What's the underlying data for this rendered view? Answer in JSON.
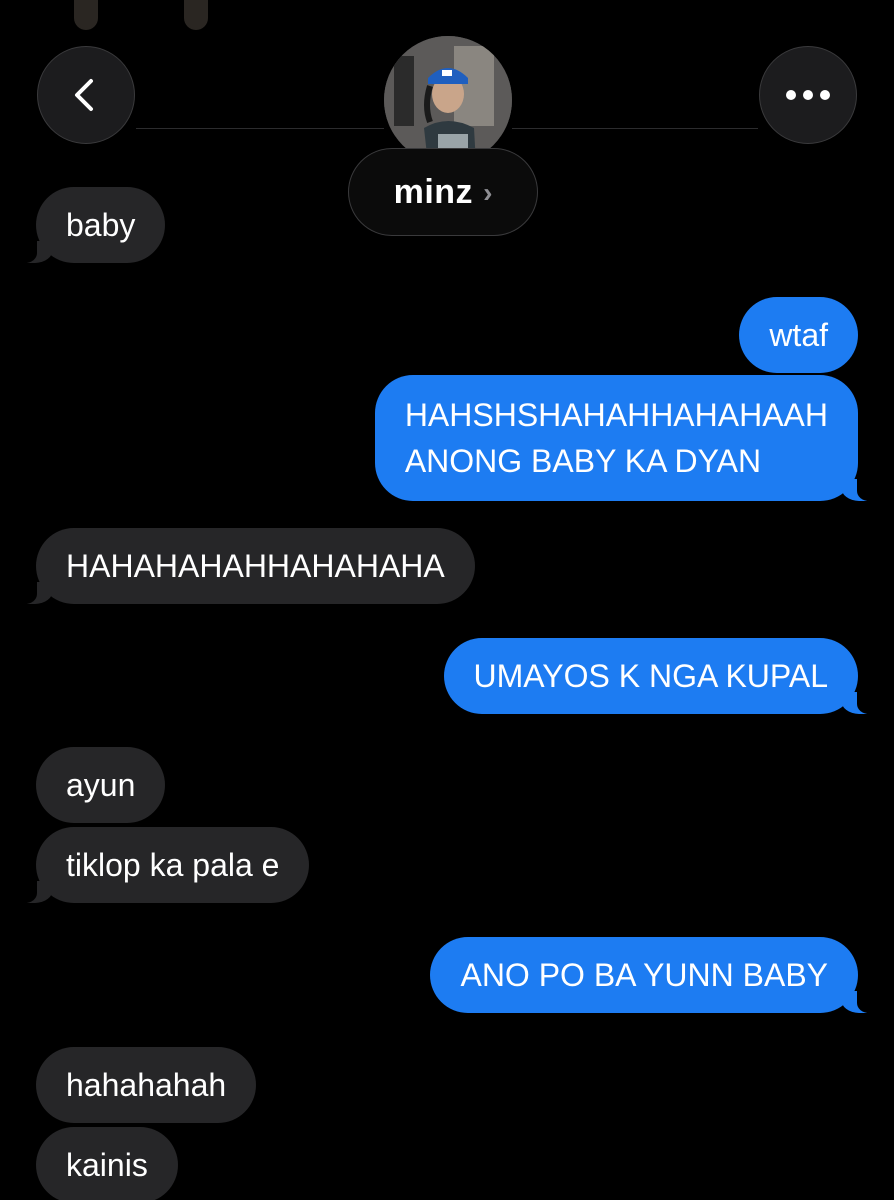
{
  "contact": {
    "name": "minz",
    "chevron": "›"
  },
  "header": {
    "back_icon": "chevron-left-icon",
    "more_icon": "ellipsis-icon"
  },
  "messages": [
    {
      "from": "them",
      "lines": [
        "baby"
      ]
    },
    {
      "from": "me",
      "lines": [
        "wtaf"
      ]
    },
    {
      "from": "me",
      "lines": [
        "HAHSHSHAHAHHAHAHAAH",
        "ANONG BABY KA DYAN"
      ]
    },
    {
      "from": "them",
      "lines": [
        "HAHAHAHAHHAHAHAHA"
      ]
    },
    {
      "from": "me",
      "lines": [
        "UMAYOS K NGA KUPAL"
      ]
    },
    {
      "from": "them",
      "lines": [
        "ayun"
      ]
    },
    {
      "from": "them",
      "lines": [
        "tiklop ka pala e"
      ]
    },
    {
      "from": "me",
      "lines": [
        "ANO PO BA YUNN BABY"
      ]
    },
    {
      "from": "them",
      "lines": [
        "hahahahah"
      ]
    },
    {
      "from": "them",
      "lines": [
        "kainis"
      ]
    }
  ],
  "colors": {
    "background": "#000000",
    "incoming_bubble": "#262628",
    "outgoing_bubble": "#1d7cf2",
    "text": "#ffffff"
  }
}
